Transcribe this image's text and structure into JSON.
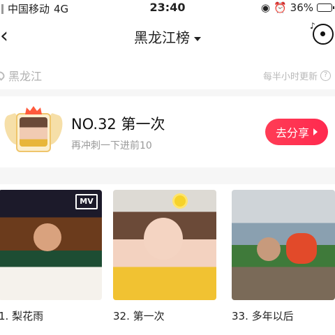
{
  "status_bar": {
    "carrier": "中国移动",
    "network": "4G",
    "time": "23:40",
    "battery_percent": "36%",
    "battery_level": 0.36
  },
  "nav": {
    "back_icon": "chevron-left-icon",
    "title": "黑龙江榜",
    "music_icon": "music-disc-icon"
  },
  "region": {
    "name": "黑龙江",
    "update_note": "每半小时更新"
  },
  "rank_card": {
    "title": "NO.32 第一次",
    "subtitle": "再冲刺一下进前10",
    "share_label": "去分享"
  },
  "videos": [
    {
      "caption": "1. 梨花雨",
      "badge": "MV"
    },
    {
      "caption": "32. 第一次"
    },
    {
      "caption": "33. 多年以后"
    }
  ],
  "colors": {
    "accent": "#ff3351",
    "muted_text": "#999999",
    "badge_gold": "#efc56b"
  }
}
